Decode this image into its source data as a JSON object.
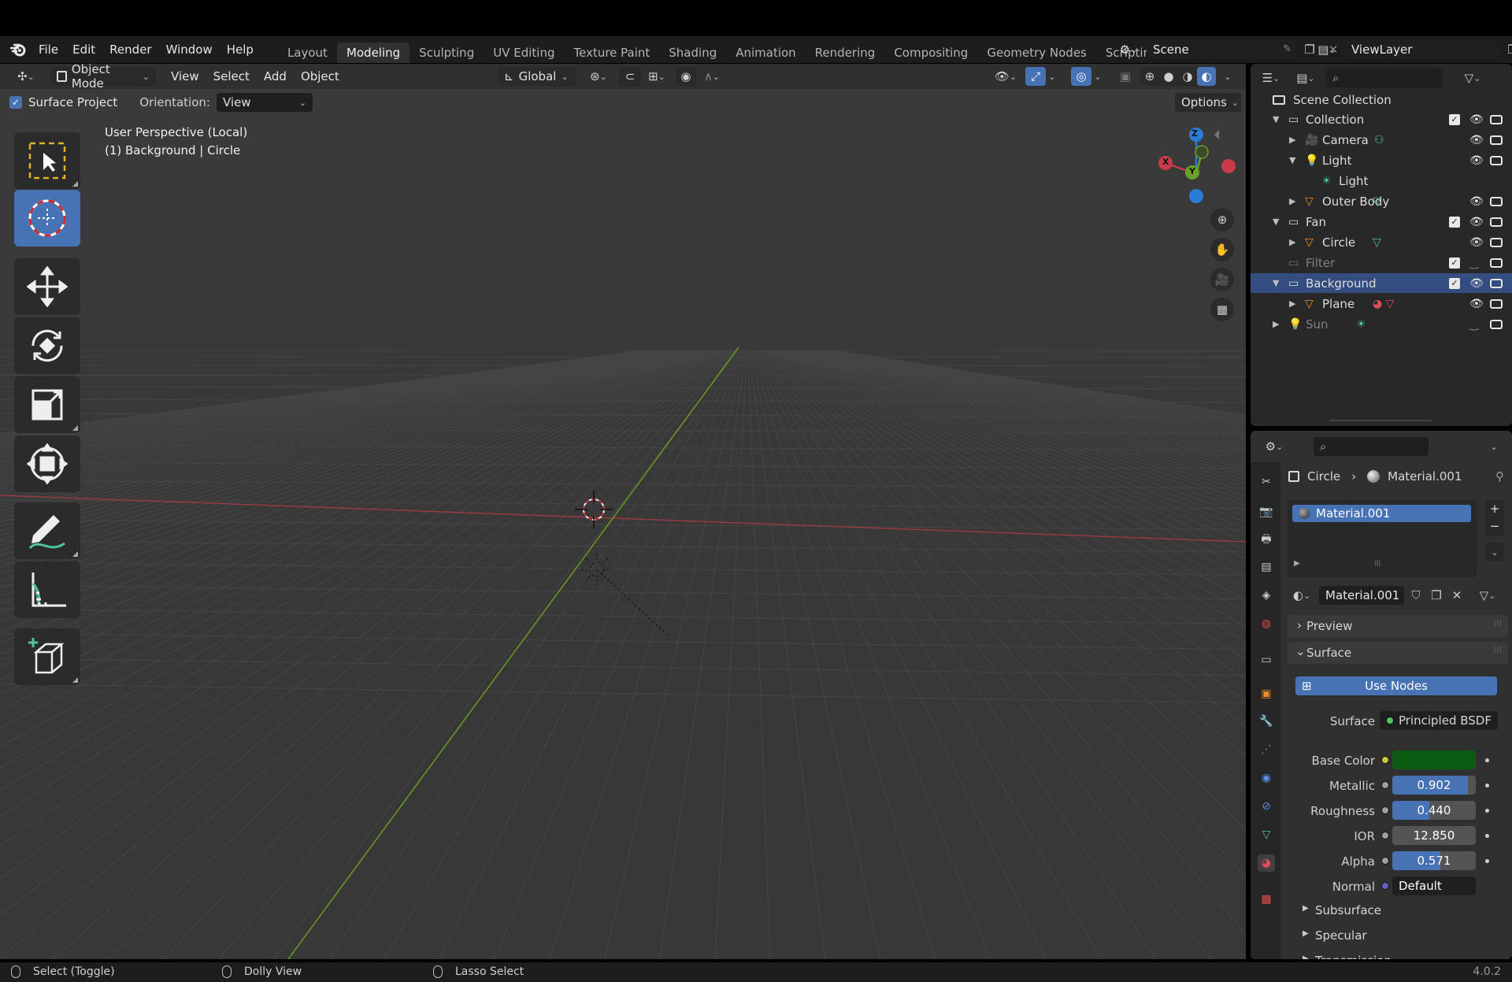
{
  "menu": {
    "items": [
      "File",
      "Edit",
      "Render",
      "Window",
      "Help"
    ]
  },
  "workspaces": {
    "tabs": [
      "Layout",
      "Modeling",
      "Sculpting",
      "UV Editing",
      "Texture Paint",
      "Shading",
      "Animation",
      "Rendering",
      "Compositing",
      "Geometry Nodes",
      "Scripting"
    ],
    "active_index": 1
  },
  "scene": {
    "name": "Scene",
    "view_layer": "ViewLayer"
  },
  "header": {
    "mode": "Object Mode",
    "menus": [
      "View",
      "Select",
      "Add",
      "Object"
    ],
    "transform_orientation": "Global"
  },
  "tool_settings": {
    "surface_project_label": "Surface Project",
    "surface_project_checked": true,
    "orientation_label": "Orientation:",
    "orientation_value": "View",
    "options_label": "Options"
  },
  "viewport": {
    "perspective": "User Perspective (Local)",
    "context": "(1) Background | Circle",
    "gizmo_axes": {
      "z": "Z",
      "x": "X",
      "y": "Y"
    }
  },
  "outliner": {
    "root": "Scene Collection",
    "rows": [
      {
        "label": "Collection",
        "indent": 0,
        "expanded": true,
        "type": "collection",
        "checkbox": true,
        "visible": true
      },
      {
        "label": "Camera",
        "indent": 1,
        "expanded": false,
        "type": "camera",
        "visible": true
      },
      {
        "label": "Light",
        "indent": 1,
        "expanded": true,
        "type": "light",
        "visible": true
      },
      {
        "label": "Light",
        "indent": 2,
        "expanded": null,
        "type": "light-data",
        "visible": null
      },
      {
        "label": "Outer Body",
        "indent": 1,
        "expanded": false,
        "type": "mesh",
        "visible": true
      },
      {
        "label": "Fan",
        "indent": 0,
        "expanded": true,
        "type": "collection",
        "checkbox": true,
        "visible": true
      },
      {
        "label": "Circle",
        "indent": 1,
        "expanded": false,
        "type": "mesh",
        "visible": true
      },
      {
        "label": "Filter",
        "indent": 0,
        "expanded": null,
        "type": "collection-disabled",
        "checkbox": true,
        "visible": false
      },
      {
        "label": "Background",
        "indent": 0,
        "expanded": true,
        "type": "collection",
        "checkbox": true,
        "visible": true,
        "selected": true
      },
      {
        "label": "Plane",
        "indent": 1,
        "expanded": false,
        "type": "mesh",
        "visible": true
      },
      {
        "label": "Sun",
        "indent": 0,
        "expanded": false,
        "type": "light-disabled",
        "visible": false
      }
    ]
  },
  "properties": {
    "breadcrumb": {
      "object": "Circle",
      "material": "Material.001"
    },
    "material_slots": [
      "Material.001"
    ],
    "material_name": "Material.001",
    "panels": {
      "preview": "Preview",
      "surface": "Surface"
    },
    "use_nodes_label": "Use Nodes",
    "surface_label": "Surface",
    "surface_shader": "Principled BSDF",
    "fields": [
      {
        "label": "Base Color",
        "type": "color",
        "color": "#0b5b12",
        "socket": "#c8c83a"
      },
      {
        "label": "Metallic",
        "type": "slider",
        "value": "0.902",
        "fraction": 0.902,
        "socket": "#a0a0a0"
      },
      {
        "label": "Roughness",
        "type": "slider",
        "value": "0.440",
        "fraction": 0.44,
        "socket": "#a0a0a0"
      },
      {
        "label": "IOR",
        "type": "number",
        "value": "12.850",
        "socket": "#a0a0a0"
      },
      {
        "label": "Alpha",
        "type": "slider",
        "value": "0.571",
        "fraction": 0.571,
        "socket": "#a0a0a0"
      },
      {
        "label": "Normal",
        "type": "text",
        "value": "Default",
        "socket": "#6363c7"
      }
    ],
    "subpanels": [
      "Subsurface",
      "Specular",
      "Transmission"
    ]
  },
  "statusbar": {
    "hints": [
      "Select (Toggle)",
      "Dolly View",
      "Lasso Select"
    ],
    "version": "4.0.2"
  },
  "colors": {
    "accent": "#4772b3",
    "selection": "#334d80",
    "x_axis": "#c93a4a",
    "y_axis": "#6aa02a",
    "z_axis": "#2c7bd6"
  }
}
